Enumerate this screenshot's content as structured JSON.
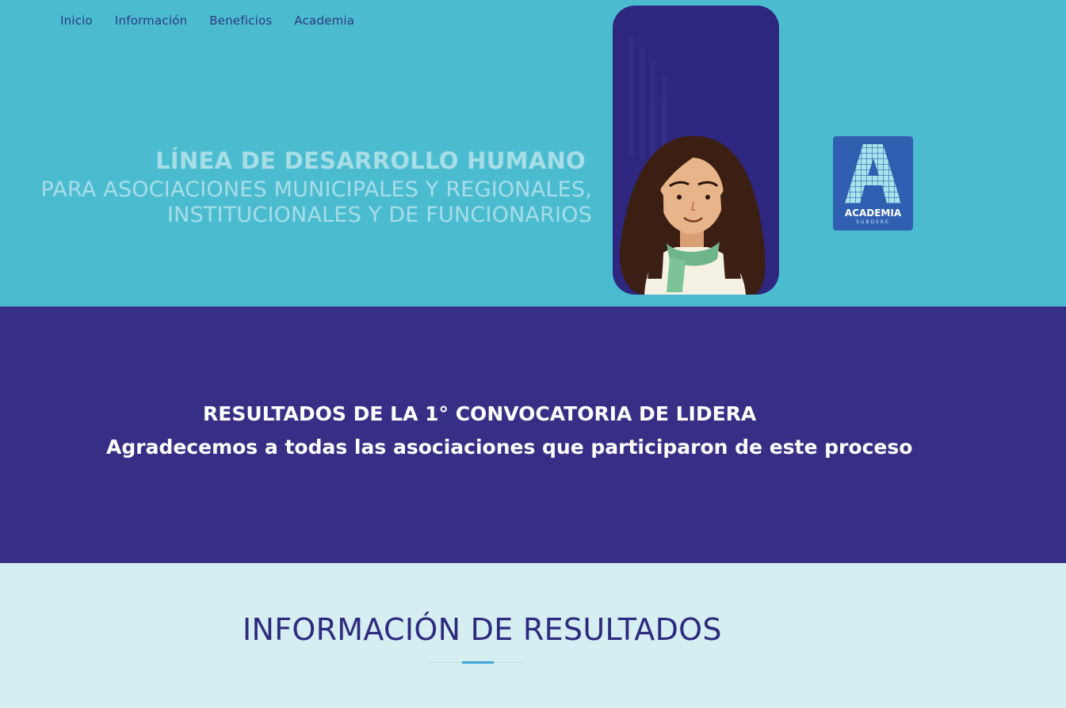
{
  "nav": {
    "items": [
      "Inicio",
      "Información",
      "Beneficios",
      "Academia"
    ]
  },
  "hero": {
    "line1": "LÍNEA DE DESARROLLO HUMANO",
    "line2": "PARA ASOCIACIONES  MUNICIPALES Y REGIONALES,",
    "line3": "INSTITUCIONALES Y DE FUNCIONARIOS",
    "logo_word": "ACADEMIA",
    "logo_sub": "SUBDERE"
  },
  "banner": {
    "title": "RESULTADOS DE LA 1° CONVOCATORIA DE LIDERA",
    "subtitle": "Agradecemos a todas las asociaciones que participaron de este proceso"
  },
  "results": {
    "title": "INFORMACIÓN DE RESULTADOS"
  },
  "colors": {
    "hero_bg": "#4bbcd0",
    "banner_bg": "#372f86",
    "results_bg": "#d4eef2",
    "nav_text": "#2e3a7d",
    "accent": "#3fa3d6"
  }
}
